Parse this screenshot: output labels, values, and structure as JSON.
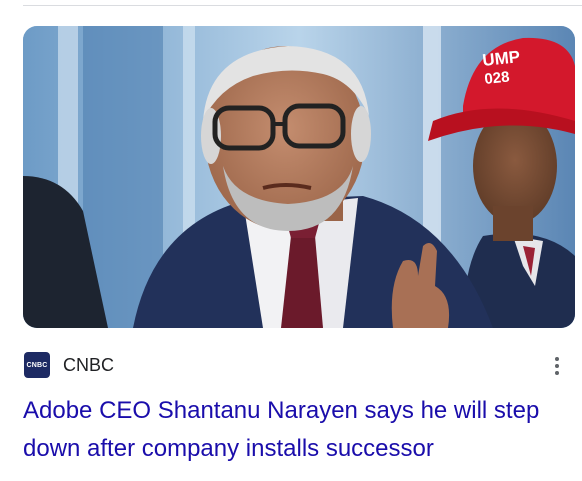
{
  "news_card": {
    "source": {
      "logo_text": "CNBC",
      "name": "CNBC"
    },
    "headline": "Adobe CEO Shantanu Narayen says he will step down after company installs successor",
    "more_options_icon": "three-dots-vertical-icon",
    "thumbnail": {
      "hat_text_line1": "UMP",
      "hat_text_line2": "028"
    }
  },
  "colors": {
    "headline": "#1a0dab",
    "source_text": "#202124",
    "icon": "#5f6368",
    "divider": "#dadce0"
  }
}
